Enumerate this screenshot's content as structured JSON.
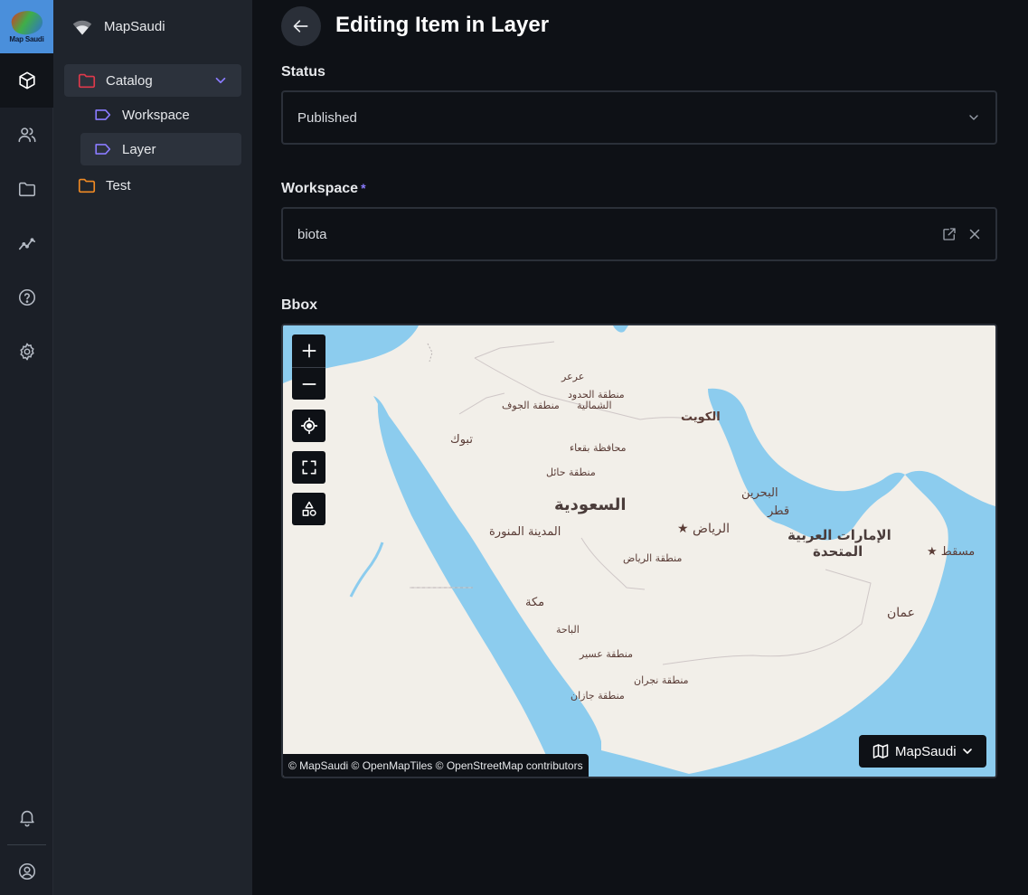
{
  "app": {
    "name": "MapSaudi",
    "logo_text": "Map Saudi"
  },
  "sidebar": {
    "items": [
      {
        "label": "Catalog"
      },
      {
        "label": "Workspace"
      },
      {
        "label": "Layer"
      },
      {
        "label": "Test"
      }
    ]
  },
  "page": {
    "title": "Editing Item in Layer"
  },
  "form": {
    "status": {
      "label": "Status",
      "value": "Published"
    },
    "workspace": {
      "label": "Workspace",
      "required_mark": "*",
      "value": "biota"
    },
    "bbox": {
      "label": "Bbox"
    }
  },
  "map": {
    "style_label": "MapSaudi",
    "attribution": "© MapSaudi © OpenMapTiles © OpenStreetMap contributors",
    "labels": {
      "arar": "عرعر",
      "northern_borders": "منطقة الحدود",
      "northern_borders_2": "الشمالية",
      "jouf": "منطقة الجوف",
      "tabuk": "تبوك",
      "kuwait": "الكويت",
      "buqaa": "محافظة بقعاء",
      "hail": "منطقة حائل",
      "saudi": "السعودية",
      "bahrain": "البحرين",
      "qatar": "قطر",
      "riyadh_city": "الرياض",
      "uae": "الإمارات العربية",
      "uae_2": "المتحدة",
      "muscat": "مسقط",
      "madinah": "المدينة المنورة",
      "riyadh_region": "منطقة الرياض",
      "makkah": "مكة",
      "oman": "عمان",
      "baha": "الباحة",
      "asir": "منطقة عسير",
      "najran": "منطقة نجران",
      "jazan": "منطقة جازان"
    }
  },
  "colors": {
    "accent": "#8a7bff",
    "catalog_folder": "#e0394b",
    "test_folder": "#f08a24",
    "water": "#8cccee",
    "land": "#f2efe9"
  }
}
